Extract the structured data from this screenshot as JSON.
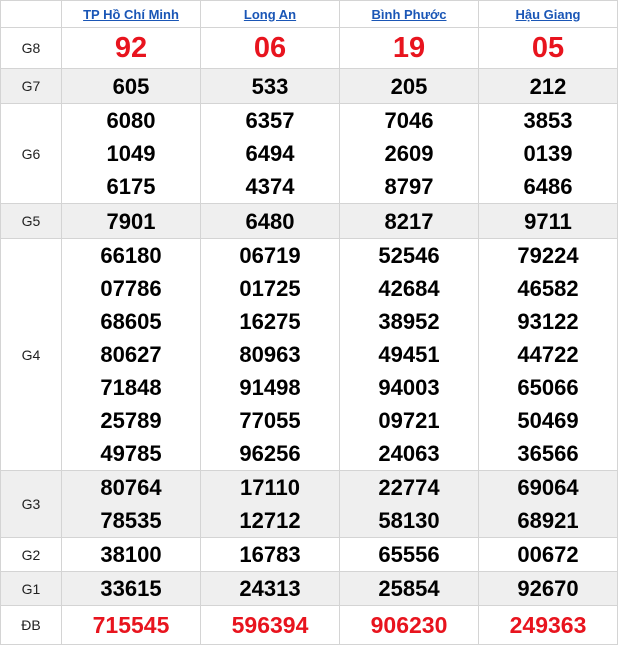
{
  "provinces": [
    "TP Hồ Chí Minh",
    "Long An",
    "Bình Phước",
    "Hậu Giang"
  ],
  "colors": {
    "link": "#1a56b6",
    "highlight": "#e8141e",
    "alt_row": "#efefef",
    "border": "#d4d4d4"
  },
  "prizes": {
    "g8": {
      "label": "G8",
      "values": [
        [
          "92"
        ],
        [
          "06"
        ],
        [
          "19"
        ],
        [
          "05"
        ]
      ]
    },
    "g7": {
      "label": "G7",
      "values": [
        [
          "605"
        ],
        [
          "533"
        ],
        [
          "205"
        ],
        [
          "212"
        ]
      ]
    },
    "g6": {
      "label": "G6",
      "values": [
        [
          "6080",
          "1049",
          "6175"
        ],
        [
          "6357",
          "6494",
          "4374"
        ],
        [
          "7046",
          "2609",
          "8797"
        ],
        [
          "3853",
          "0139",
          "6486"
        ]
      ]
    },
    "g5": {
      "label": "G5",
      "values": [
        [
          "7901"
        ],
        [
          "6480"
        ],
        [
          "8217"
        ],
        [
          "9711"
        ]
      ]
    },
    "g4": {
      "label": "G4",
      "values": [
        [
          "66180",
          "07786",
          "68605",
          "80627",
          "71848",
          "25789",
          "49785"
        ],
        [
          "06719",
          "01725",
          "16275",
          "80963",
          "91498",
          "77055",
          "96256"
        ],
        [
          "52546",
          "42684",
          "38952",
          "49451",
          "94003",
          "09721",
          "24063"
        ],
        [
          "79224",
          "46582",
          "93122",
          "44722",
          "65066",
          "50469",
          "36566"
        ]
      ]
    },
    "g3": {
      "label": "G3",
      "values": [
        [
          "80764",
          "78535"
        ],
        [
          "17110",
          "12712"
        ],
        [
          "22774",
          "58130"
        ],
        [
          "69064",
          "68921"
        ]
      ]
    },
    "g2": {
      "label": "G2",
      "values": [
        [
          "38100"
        ],
        [
          "16783"
        ],
        [
          "65556"
        ],
        [
          "00672"
        ]
      ]
    },
    "g1": {
      "label": "G1",
      "values": [
        [
          "33615"
        ],
        [
          "24313"
        ],
        [
          "25854"
        ],
        [
          "92670"
        ]
      ]
    },
    "db": {
      "label": "ĐB",
      "values": [
        [
          "715545"
        ],
        [
          "596394"
        ],
        [
          "906230"
        ],
        [
          "249363"
        ]
      ]
    }
  }
}
